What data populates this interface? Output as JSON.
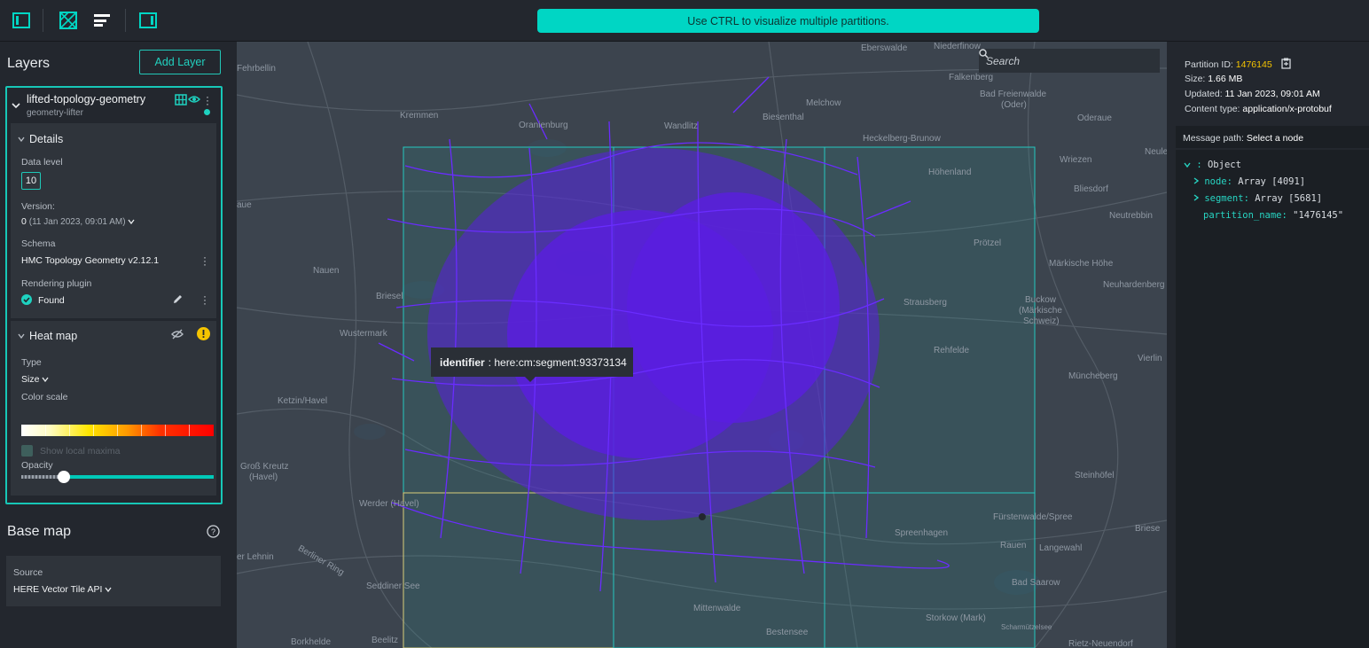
{
  "notice": "Use CTRL to visualize multiple partitions.",
  "topbar": {
    "icons": [
      "panel-left-icon",
      "grid-tile-icon",
      "list-lines-icon",
      "panel-right-icon"
    ]
  },
  "left_panel": {
    "title": "Layers",
    "add_button": "Add Layer",
    "layer": {
      "name": "lifted-topology-geometry",
      "subtitle": "geometry-lifter",
      "details": {
        "title": "Details",
        "data_level_label": "Data level",
        "data_level_value": "10",
        "version_label": "Version:",
        "version_value": "0",
        "version_date": "(11 Jan 2023, 09:01 AM)",
        "schema_label": "Schema",
        "schema_value": "HMC Topology Geometry v2.12.1",
        "rendering_label": "Rendering plugin",
        "rendering_value": "Found"
      },
      "heatmap": {
        "title": "Heat map",
        "type_label": "Type",
        "type_value": "Size",
        "color_scale_label": "Color scale",
        "local_maxima_label": "Show local maxima",
        "opacity_label": "Opacity",
        "opacity_value": 0.2
      }
    },
    "basemap": {
      "title": "Base map",
      "source_label": "Source",
      "source_value": "HERE Vector Tile API"
    }
  },
  "map": {
    "search_placeholder": "Search",
    "tooltip_key": "identifier",
    "tooltip_value": ": here:cm:segment:93373134",
    "labels": [
      {
        "text": "Eberswalde"
      },
      {
        "text": "Niederfinow"
      },
      {
        "text": "Falkenberg"
      },
      {
        "text": "Bad Freienwalde"
      },
      {
        "text": "(Oder)"
      },
      {
        "text": "Oderaue"
      },
      {
        "text": "Fehrbellin"
      },
      {
        "text": "Kremmen"
      },
      {
        "text": "Oranienburg"
      },
      {
        "text": "Wandlitz"
      },
      {
        "text": "Biesenthal"
      },
      {
        "text": "Melchow"
      },
      {
        "text": "Heckelberg-Brunow"
      },
      {
        "text": "Wriezen"
      },
      {
        "text": "Höhenland"
      },
      {
        "text": "Bliesdorf"
      },
      {
        "text": "Neutrebbin"
      },
      {
        "text": "Prötzel"
      },
      {
        "text": "Märkische Höhe"
      },
      {
        "text": "Neuhardenberg"
      },
      {
        "text": "Nauen"
      },
      {
        "text": "Strausberg"
      },
      {
        "text": "Buckow"
      },
      {
        "text": "(Märkische"
      },
      {
        "text": "Schweiz)"
      },
      {
        "text": "Wustermark"
      },
      {
        "text": "Rehfelde"
      },
      {
        "text": "Müncheberg"
      },
      {
        "text": "Ketzin/Havel"
      },
      {
        "text": "Groß Kreutz"
      },
      {
        "text": "(Havel)"
      },
      {
        "text": "Werder (Havel)"
      },
      {
        "text": "Steinhöfel"
      },
      {
        "text": "Fürstenwalde/Spree"
      },
      {
        "text": "Spreenhagen"
      },
      {
        "text": "Rauen"
      },
      {
        "text": "Langewahl"
      },
      {
        "text": "Bad Saarow"
      },
      {
        "text": "Storkow (Mark)"
      },
      {
        "text": "Mittenwalde"
      },
      {
        "text": "Bestensee"
      },
      {
        "text": "Borkhelde"
      },
      {
        "text": "Beelitz"
      },
      {
        "text": "Seddiner See"
      },
      {
        "text": "Briese"
      },
      {
        "text": "Vierlin"
      },
      {
        "text": "Neule"
      },
      {
        "text": "aue"
      },
      {
        "text": "Briesel"
      },
      {
        "text": "er Lehnin"
      },
      {
        "text": "Berliner Ring"
      },
      {
        "text": "Scharmützelsee"
      },
      {
        "text": "Rietz-Neuendorf"
      }
    ]
  },
  "right_panel": {
    "partition_label": "Partition ID:",
    "partition_id": "1476145",
    "size_label": "Size:",
    "size_value": "1.66 MB",
    "updated_label": "Updated:",
    "updated_value": "11 Jan 2023, 09:01 AM",
    "content_label": "Content type:",
    "content_value": "application/x-protobuf",
    "message_path_label": "Message path:",
    "message_path_value": "Select a node",
    "tree": {
      "root_key": ": ",
      "root_value": "Object",
      "node_key": "node:",
      "node_value": "Array [4091]",
      "segment_key": "segment:",
      "segment_value": "Array [5681]",
      "partition_key": "partition_name:",
      "partition_value": "\"1476145\""
    }
  },
  "colors": {
    "accent": "#00d6c4",
    "network": "#5a1ee0",
    "partition_id": "#f5c400",
    "warning": "#f5c400"
  }
}
